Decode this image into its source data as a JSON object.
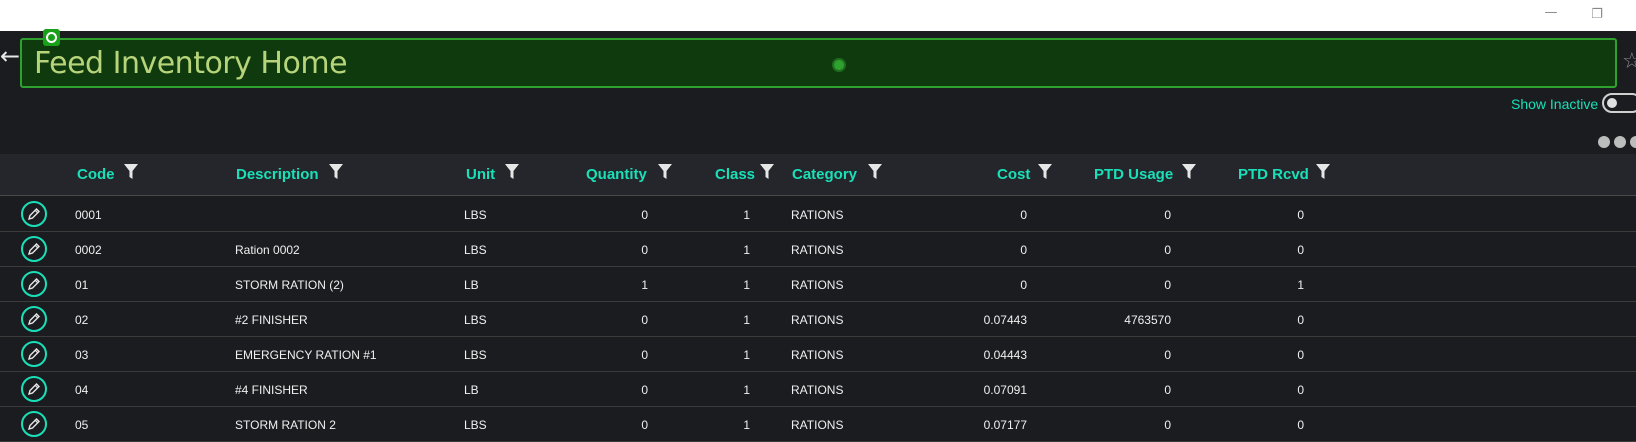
{
  "window": {
    "minimize_glyph": "—",
    "restore_glyph": "❐"
  },
  "header": {
    "title": "Feed Inventory Home",
    "show_inactive_label": "Show Inactive"
  },
  "icons": {
    "back": "←",
    "star": "☆"
  },
  "columns": [
    "Code",
    "Description",
    "Unit",
    "Quantity",
    "Class",
    "Category",
    "Cost",
    "PTD Usage",
    "PTD Rcvd"
  ],
  "rows": [
    {
      "code": "0001",
      "description": "",
      "unit": "LBS",
      "quantity": "0",
      "class": "1",
      "category": "RATIONS",
      "cost": "0",
      "ptd_usage": "0",
      "ptd_rcvd": "0"
    },
    {
      "code": "0002",
      "description": "Ration 0002",
      "unit": "LBS",
      "quantity": "0",
      "class": "1",
      "category": "RATIONS",
      "cost": "0",
      "ptd_usage": "0",
      "ptd_rcvd": "0"
    },
    {
      "code": "01",
      "description": "STORM RATION (2)",
      "unit": "LB",
      "quantity": "1",
      "class": "1",
      "category": "RATIONS",
      "cost": "0",
      "ptd_usage": "0",
      "ptd_rcvd": "1"
    },
    {
      "code": "02",
      "description": "#2 FINISHER",
      "unit": "LBS",
      "quantity": "0",
      "class": "1",
      "category": "RATIONS",
      "cost": "0.07443",
      "ptd_usage": "4763570",
      "ptd_rcvd": "0"
    },
    {
      "code": "03",
      "description": "EMERGENCY RATION #1",
      "unit": "LBS",
      "quantity": "0",
      "class": "1",
      "category": "RATIONS",
      "cost": "0.04443",
      "ptd_usage": "0",
      "ptd_rcvd": "0"
    },
    {
      "code": "04",
      "description": "#4 FINISHER",
      "unit": "LB",
      "quantity": "0",
      "class": "1",
      "category": "RATIONS",
      "cost": "0.07091",
      "ptd_usage": "0",
      "ptd_rcvd": "0"
    },
    {
      "code": "05",
      "description": "STORM RATION 2",
      "unit": "LBS",
      "quantity": "0",
      "class": "1",
      "category": "RATIONS",
      "cost": "0.07177",
      "ptd_usage": "0",
      "ptd_rcvd": "0"
    }
  ],
  "colors": {
    "accent": "#19e0b8",
    "title_box_bg": "#0e3a0e",
    "title_box_border": "#2fa12f",
    "title_text": "#b7d47a",
    "background": "#1b1c20"
  }
}
